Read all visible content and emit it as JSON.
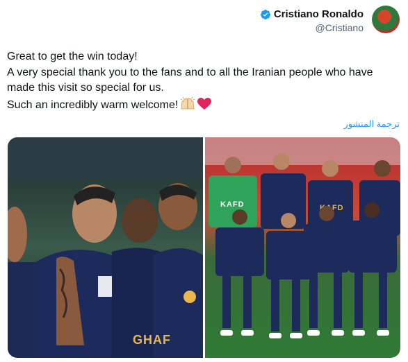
{
  "author": {
    "name": "Cristiano Ronaldo",
    "handle": "@Cristiano",
    "verified": true,
    "avatar_icon": "profile-avatar"
  },
  "tweet": {
    "lines": [
      "Great to get the win today!",
      "A very special thank you to the fans and to all the Iranian people who have",
      "made this visit so special for us.",
      "Such an incredibly warm welcome!"
    ],
    "emojis": [
      "raising-hands-icon",
      "red-heart-icon"
    ]
  },
  "translate_label": "ترجمة المنشور",
  "media": {
    "images": [
      {
        "name": "celebration-photo",
        "sponsor_text": "GHAF"
      },
      {
        "name": "team-photo",
        "sponsor_text": "KAFD"
      }
    ]
  },
  "colors": {
    "verified": "#1d9bf0",
    "link": "#1d9bf0",
    "kit_navy": "#1d2a5c",
    "goalkeeper_green": "#2fa35a"
  }
}
